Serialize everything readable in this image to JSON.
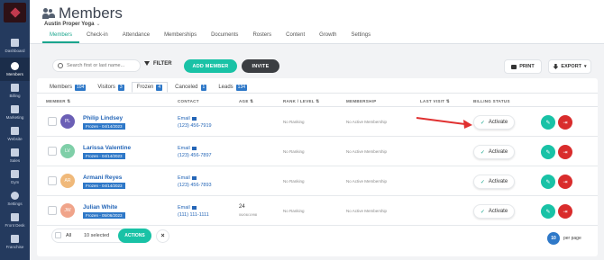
{
  "sidebar": {
    "items": [
      {
        "label": "Dashboard"
      },
      {
        "label": "Members"
      },
      {
        "label": "Billing"
      },
      {
        "label": "Marketing"
      },
      {
        "label": "Website"
      },
      {
        "label": "Sales"
      },
      {
        "label": "Gym"
      },
      {
        "label": "Settings"
      },
      {
        "label": "Front Desk"
      },
      {
        "label": "Franchise"
      }
    ]
  },
  "header": {
    "title": "Members",
    "studio": "Austin Proper Yoga",
    "tabs": [
      "Members",
      "Check-in",
      "Attendance",
      "Memberships",
      "Documents",
      "Rosters",
      "Content",
      "Growth",
      "Settings"
    ]
  },
  "toolbar": {
    "search_placeholder": "Search first or last name...",
    "filter_label": "FILTER",
    "add_member_label": "ADD MEMBER",
    "invite_label": "INVITE",
    "print_label": "PRINT",
    "export_label": "EXPORT"
  },
  "subtabs": [
    {
      "label": "Members",
      "count": "104"
    },
    {
      "label": "Visitors",
      "count": "3"
    },
    {
      "label": "Frozen",
      "count": "4"
    },
    {
      "label": "Canceled",
      "count": "1"
    },
    {
      "label": "Leads",
      "count": "134"
    }
  ],
  "columns": [
    "MEMBER",
    "CONTACT",
    "AGE",
    "RANK / LEVEL",
    "MEMBERSHIP",
    "LAST VISIT",
    "BILLING STATUS"
  ],
  "rows": [
    {
      "initials": "PL",
      "color": "#6b5fb5",
      "name": "Philip Lindsey",
      "frozen": "Frozen - 04/14/2023",
      "email": "Email",
      "phone": "(123) 456-7919",
      "age": "",
      "dob": "",
      "rank": "No Ranking",
      "membership": "No Active Membership",
      "status": "Activate"
    },
    {
      "initials": "LV",
      "color": "#7fcfa8",
      "name": "Larissa Valentine",
      "frozen": "Frozen - 04/14/2023",
      "email": "Email",
      "phone": "(123) 456-7897",
      "age": "",
      "dob": "",
      "rank": "No Ranking",
      "membership": "No Active Membership",
      "status": "Activate"
    },
    {
      "initials": "AR",
      "color": "#f0b97a",
      "name": "Armani Reyes",
      "frozen": "Frozen - 04/14/2023",
      "email": "Email",
      "phone": "(123) 456-7893",
      "age": "",
      "dob": "",
      "rank": "No Ranking",
      "membership": "No Active Membership",
      "status": "Activate"
    },
    {
      "initials": "JW",
      "color": "#f0a48a",
      "name": "Julian White",
      "frozen": "Frozen - 05/06/2023",
      "email": "Email",
      "phone": "(111) 111-1111",
      "age": "24",
      "dob": "06/06/1998",
      "rank": "No Ranking",
      "membership": "No Active Membership",
      "status": "Activate"
    }
  ],
  "bulk": {
    "all_label": "All",
    "selected_label": "10 selected",
    "actions_label": "ACTIONS",
    "close_label": "×"
  },
  "pagination": {
    "per_page": "10",
    "per_page_label": "per page"
  },
  "colors": {
    "accent": "#19c2a6",
    "link": "#2566b7",
    "badge": "#2e78c8",
    "danger": "#d92c2c",
    "sidebar": "#243a5e"
  }
}
